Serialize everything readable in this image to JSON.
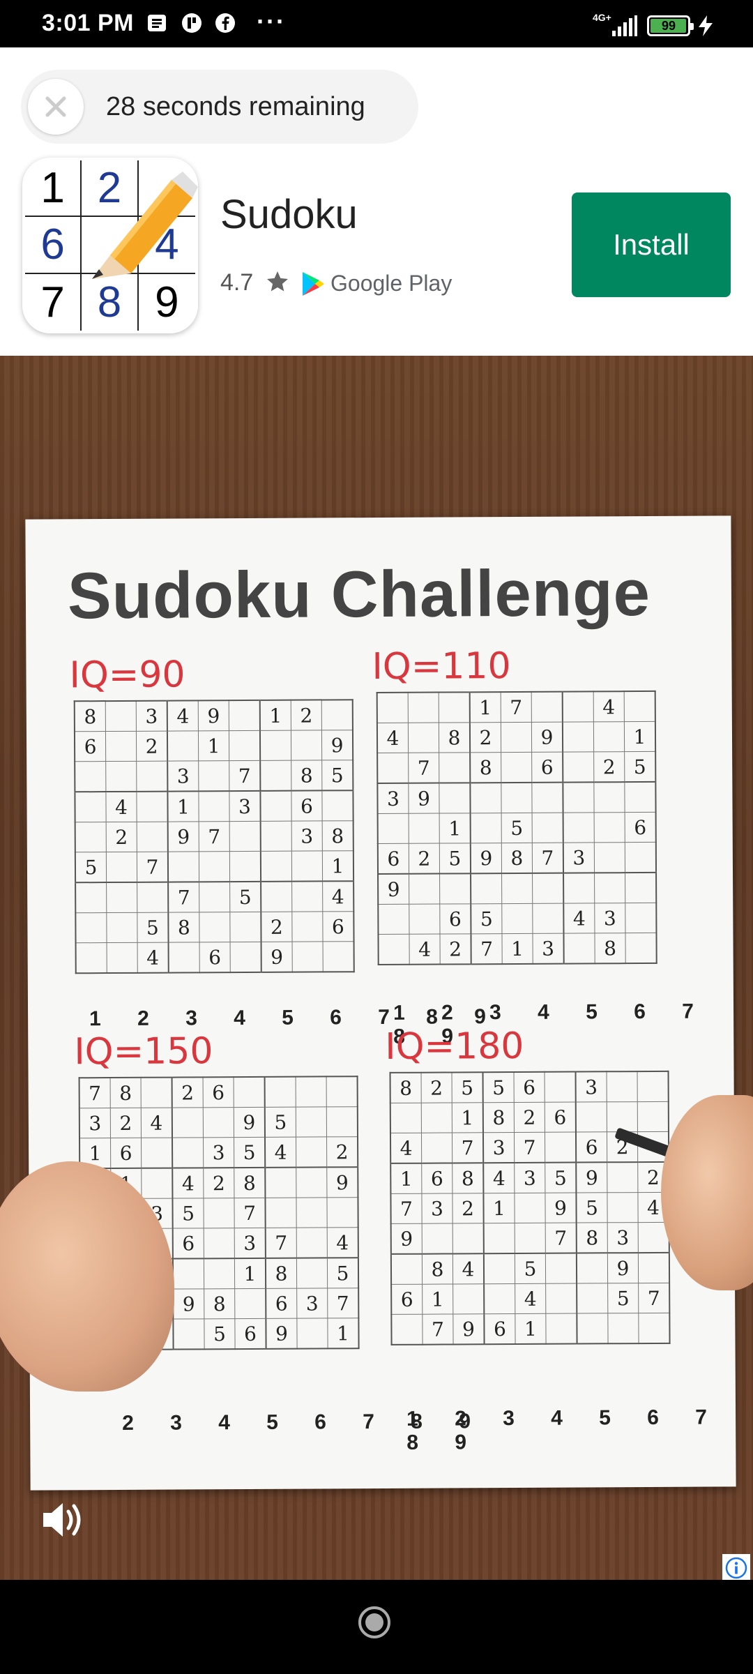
{
  "status_bar": {
    "time": "3:01 PM",
    "notification_icons": [
      "document-icon",
      "app-icon",
      "facebook-icon"
    ],
    "more": "···",
    "network": "4G+",
    "battery": "99"
  },
  "ad": {
    "timer_text": "28 seconds remaining",
    "app_name": "Sudoku",
    "rating": "4.7",
    "store": "Google Play",
    "install_label": "Install",
    "icon_digits": [
      "1",
      "2",
      "",
      "6",
      "",
      "4",
      "7",
      "8",
      "9"
    ],
    "colors": {
      "install_bg": "#01875f",
      "blue_digit": "#1f3a93"
    }
  },
  "video": {
    "title": "Sudoku Challenge",
    "puzzles": [
      {
        "label": "IQ=90",
        "rows": [
          [
            "8",
            "",
            "3",
            "4",
            "9",
            "",
            "1",
            "2",
            ""
          ],
          [
            "6",
            "",
            "2",
            "",
            "1",
            "",
            "",
            "",
            "9"
          ],
          [
            "",
            "",
            "",
            "3",
            "",
            "7",
            "",
            "8",
            "5"
          ],
          [
            "",
            "4",
            "",
            "1",
            "",
            "3",
            "",
            "6",
            ""
          ],
          [
            "",
            "2",
            "",
            "9",
            "7",
            "",
            "",
            "3",
            "8"
          ],
          [
            "5",
            "",
            "7",
            "",
            "",
            "",
            "",
            "",
            "1"
          ],
          [
            "",
            "",
            "",
            "7",
            "",
            "5",
            "",
            "",
            "4"
          ],
          [
            "",
            "",
            "5",
            "8",
            "",
            "",
            "2",
            "",
            "6"
          ],
          [
            "",
            "",
            "4",
            "",
            "6",
            "",
            "9",
            "",
            ""
          ]
        ]
      },
      {
        "label": "IQ=110",
        "rows": [
          [
            "",
            "",
            "",
            "1",
            "7",
            "",
            "",
            "4",
            ""
          ],
          [
            "4",
            "",
            "8",
            "2",
            "",
            "9",
            "",
            "",
            "1"
          ],
          [
            "",
            "7",
            "",
            "8",
            "",
            "6",
            "",
            "2",
            "5"
          ],
          [
            "3",
            "9",
            "",
            "",
            "",
            "",
            "",
            "",
            ""
          ],
          [
            "",
            "",
            "1",
            "",
            "5",
            "",
            "",
            "",
            "6"
          ],
          [
            "6",
            "2",
            "5",
            "9",
            "8",
            "7",
            "3",
            "",
            ""
          ],
          [
            "9",
            "",
            "",
            "",
            "",
            "",
            "",
            "",
            ""
          ],
          [
            "",
            "",
            "6",
            "5",
            "",
            "",
            "4",
            "3",
            ""
          ],
          [
            "",
            "4",
            "2",
            "7",
            "1",
            "3",
            "",
            "8",
            ""
          ]
        ]
      },
      {
        "label": "IQ=150",
        "rows": [
          [
            "7",
            "8",
            "",
            "2",
            "6",
            "",
            "",
            "",
            ""
          ],
          [
            "3",
            "2",
            "4",
            "",
            "",
            "9",
            "5",
            "",
            ""
          ],
          [
            "1",
            "6",
            "",
            "",
            "3",
            "5",
            "4",
            "",
            "2"
          ],
          [
            "",
            "1",
            "",
            "4",
            "2",
            "8",
            "",
            "",
            "9"
          ],
          [
            "",
            "",
            "3",
            "5",
            "",
            "7",
            "",
            "",
            ""
          ],
          [
            "",
            "",
            "",
            "6",
            "",
            "3",
            "7",
            "",
            "4"
          ],
          [
            "",
            "",
            "",
            "",
            "",
            "1",
            "8",
            "",
            "5"
          ],
          [
            "",
            "",
            "",
            "9",
            "8",
            "",
            "6",
            "3",
            "7"
          ],
          [
            "",
            "",
            "",
            "",
            "5",
            "6",
            "9",
            "",
            "1"
          ]
        ]
      },
      {
        "label": "IQ=180",
        "rows": [
          [
            "8",
            "2",
            "5",
            "5",
            "6",
            "",
            "3",
            "",
            ""
          ],
          [
            "",
            "",
            "1",
            "8",
            "2",
            "6",
            "",
            "",
            ""
          ],
          [
            "4",
            "",
            "7",
            "3",
            "7",
            "",
            "6",
            "2",
            ""
          ],
          [
            "1",
            "6",
            "8",
            "4",
            "3",
            "5",
            "9",
            "",
            "2"
          ],
          [
            "7",
            "3",
            "2",
            "1",
            "",
            "9",
            "5",
            "",
            "4"
          ],
          [
            "9",
            "",
            "",
            "",
            "",
            "7",
            "8",
            "3",
            ""
          ],
          [
            "",
            "8",
            "4",
            "",
            "5",
            "",
            "",
            "9",
            ""
          ],
          [
            "6",
            "1",
            "",
            "",
            "4",
            "",
            "",
            "5",
            "7"
          ],
          [
            "",
            "7",
            "9",
            "6",
            "1",
            "",
            "",
            "",
            ""
          ]
        ]
      }
    ],
    "number_row": "1 2 3 4 5 6 7 8 9",
    "number_row_partial": "2 3 4 5 6 7 8 9"
  }
}
